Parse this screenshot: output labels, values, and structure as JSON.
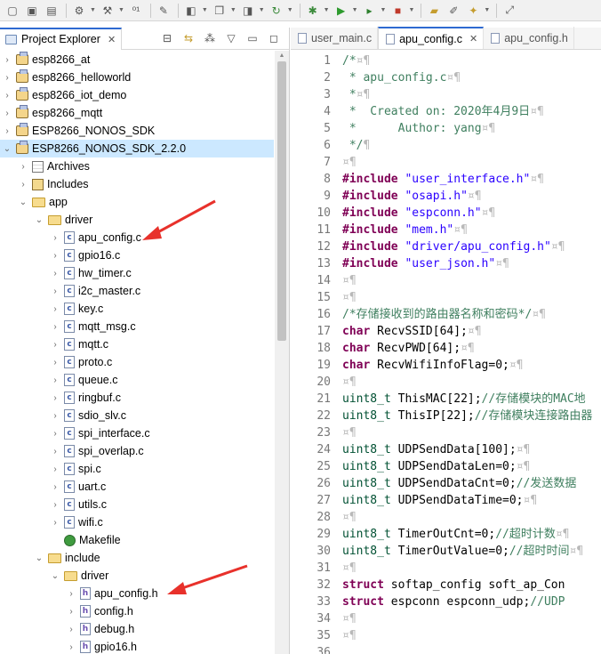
{
  "explorer": {
    "title": "Project Explorer",
    "close": "✕",
    "tree": [
      {
        "label": "esp8266_at",
        "kind": "project",
        "depth": 0,
        "twisty": "›"
      },
      {
        "label": "esp8266_helloworld",
        "kind": "project",
        "depth": 0,
        "twisty": "›"
      },
      {
        "label": "esp8266_iot_demo",
        "kind": "project",
        "depth": 0,
        "twisty": "›"
      },
      {
        "label": "esp8266_mqtt",
        "kind": "project",
        "depth": 0,
        "twisty": "›"
      },
      {
        "label": "ESP8266_NONOS_SDK",
        "kind": "project",
        "depth": 0,
        "twisty": "›"
      },
      {
        "label": "ESP8266_NONOS_SDK_2.2.0",
        "kind": "project",
        "depth": 0,
        "twisty": "⌄",
        "selected": true
      },
      {
        "label": "Archives",
        "kind": "archive",
        "depth": 1,
        "twisty": "›"
      },
      {
        "label": "Includes",
        "kind": "includes",
        "depth": 1,
        "twisty": "›"
      },
      {
        "label": "app",
        "kind": "folder-open",
        "depth": 1,
        "twisty": "⌄"
      },
      {
        "label": "driver",
        "kind": "folder-open",
        "depth": 2,
        "twisty": "⌄"
      },
      {
        "label": "apu_config.c",
        "kind": "c",
        "depth": 3,
        "twisty": "›"
      },
      {
        "label": "gpio16.c",
        "kind": "c",
        "depth": 3,
        "twisty": "›"
      },
      {
        "label": "hw_timer.c",
        "kind": "c",
        "depth": 3,
        "twisty": "›"
      },
      {
        "label": "i2c_master.c",
        "kind": "c",
        "depth": 3,
        "twisty": "›"
      },
      {
        "label": "key.c",
        "kind": "c",
        "depth": 3,
        "twisty": "›"
      },
      {
        "label": "mqtt_msg.c",
        "kind": "c",
        "depth": 3,
        "twisty": "›"
      },
      {
        "label": "mqtt.c",
        "kind": "c",
        "depth": 3,
        "twisty": "›"
      },
      {
        "label": "proto.c",
        "kind": "c",
        "depth": 3,
        "twisty": "›"
      },
      {
        "label": "queue.c",
        "kind": "c",
        "depth": 3,
        "twisty": "›"
      },
      {
        "label": "ringbuf.c",
        "kind": "c",
        "depth": 3,
        "twisty": "›"
      },
      {
        "label": "sdio_slv.c",
        "kind": "c",
        "depth": 3,
        "twisty": "›"
      },
      {
        "label": "spi_interface.c",
        "kind": "c",
        "depth": 3,
        "twisty": "›"
      },
      {
        "label": "spi_overlap.c",
        "kind": "c",
        "depth": 3,
        "twisty": "›"
      },
      {
        "label": "spi.c",
        "kind": "c",
        "depth": 3,
        "twisty": "›"
      },
      {
        "label": "uart.c",
        "kind": "c",
        "depth": 3,
        "twisty": "›"
      },
      {
        "label": "utils.c",
        "kind": "c",
        "depth": 3,
        "twisty": "›"
      },
      {
        "label": "wifi.c",
        "kind": "c",
        "depth": 3,
        "twisty": "›"
      },
      {
        "label": "Makefile",
        "kind": "make",
        "depth": 3,
        "twisty": ""
      },
      {
        "label": "include",
        "kind": "folder-open",
        "depth": 2,
        "twisty": "⌄"
      },
      {
        "label": "driver",
        "kind": "folder-open",
        "depth": 3,
        "twisty": "⌄"
      },
      {
        "label": "apu_config.h",
        "kind": "h",
        "depth": 4,
        "twisty": "›"
      },
      {
        "label": "config.h",
        "kind": "h",
        "depth": 4,
        "twisty": "›"
      },
      {
        "label": "debug.h",
        "kind": "h",
        "depth": 4,
        "twisty": "›"
      },
      {
        "label": "gpio16.h",
        "kind": "h",
        "depth": 4,
        "twisty": "›"
      }
    ]
  },
  "editor": {
    "tabs": [
      {
        "label": "user_main.c",
        "active": false,
        "close": ""
      },
      {
        "label": "apu_config.c",
        "active": true,
        "close": "✕"
      },
      {
        "label": "apu_config.h",
        "active": false,
        "close": ""
      }
    ],
    "lines": [
      [
        {
          "t": "/*",
          "c": "cm"
        },
        {
          "t": "¤¶",
          "c": "ws"
        }
      ],
      [
        {
          "t": " * ",
          "c": "cm"
        },
        {
          "t": "apu_config.c",
          "c": "cm"
        },
        {
          "t": "¤¶",
          "c": "ws"
        }
      ],
      [
        {
          "t": " *",
          "c": "cm"
        },
        {
          "t": "¤¶",
          "c": "ws"
        }
      ],
      [
        {
          "t": " *  Created on: 2020年4月9日",
          "c": "cm"
        },
        {
          "t": "¤¶",
          "c": "ws"
        }
      ],
      [
        {
          "t": " *      Author: yang",
          "c": "cm"
        },
        {
          "t": "¤¶",
          "c": "ws"
        }
      ],
      [
        {
          "t": " */",
          "c": "cm"
        },
        {
          "t": "¶",
          "c": "ws"
        }
      ],
      [
        {
          "t": "¤¶",
          "c": "ws"
        }
      ],
      [
        {
          "t": "#include ",
          "c": "kw"
        },
        {
          "t": "\"user_interface.h\"",
          "c": "st"
        },
        {
          "t": "¤¶",
          "c": "ws"
        }
      ],
      [
        {
          "t": "#include ",
          "c": "kw"
        },
        {
          "t": "\"osapi.h\"",
          "c": "st"
        },
        {
          "t": "¤¶",
          "c": "ws"
        }
      ],
      [
        {
          "t": "#include ",
          "c": "kw"
        },
        {
          "t": "\"espconn.h\"",
          "c": "st"
        },
        {
          "t": "¤¶",
          "c": "ws"
        }
      ],
      [
        {
          "t": "#include ",
          "c": "kw"
        },
        {
          "t": "\"mem.h\"",
          "c": "st"
        },
        {
          "t": "¤¶",
          "c": "ws"
        }
      ],
      [
        {
          "t": "#include ",
          "c": "kw"
        },
        {
          "t": "\"driver/apu_config.h\"",
          "c": "st"
        },
        {
          "t": "¤¶",
          "c": "ws"
        }
      ],
      [
        {
          "t": "#include ",
          "c": "kw"
        },
        {
          "t": "\"user_json.h\"",
          "c": "st"
        },
        {
          "t": "¤¶",
          "c": "ws"
        }
      ],
      [
        {
          "t": "¤¶",
          "c": "ws"
        }
      ],
      [
        {
          "t": "¤¶",
          "c": "ws"
        }
      ],
      [
        {
          "t": "/*存储接收到的路由器名称和密码*/",
          "c": "cm"
        },
        {
          "t": "¤¶",
          "c": "ws"
        }
      ],
      [
        {
          "t": "char ",
          "c": "kw"
        },
        {
          "t": "RecvSSID[64];",
          "c": ""
        },
        {
          "t": "¤¶",
          "c": "ws"
        }
      ],
      [
        {
          "t": "char ",
          "c": "kw"
        },
        {
          "t": "RecvPWD[64];",
          "c": ""
        },
        {
          "t": "¤¶",
          "c": "ws"
        }
      ],
      [
        {
          "t": "char ",
          "c": "kw"
        },
        {
          "t": "RecvWifiInfoFlag=0;",
          "c": ""
        },
        {
          "t": "¤¶",
          "c": "ws"
        }
      ],
      [
        {
          "t": "¤¶",
          "c": "ws"
        }
      ],
      [
        {
          "t": "uint8_t ",
          "c": "ty"
        },
        {
          "t": "ThisMAC[22];",
          "c": ""
        },
        {
          "t": "//存储模块的MAC地",
          "c": "cm"
        }
      ],
      [
        {
          "t": "uint8_t ",
          "c": "ty"
        },
        {
          "t": "ThisIP[22];",
          "c": ""
        },
        {
          "t": "//存储模块连接路由器",
          "c": "cm"
        }
      ],
      [
        {
          "t": "¤¶",
          "c": "ws"
        }
      ],
      [
        {
          "t": "uint8_t ",
          "c": "ty"
        },
        {
          "t": "UDPSendData[100];",
          "c": ""
        },
        {
          "t": "¤¶",
          "c": "ws"
        }
      ],
      [
        {
          "t": "uint8_t ",
          "c": "ty"
        },
        {
          "t": "UDPSendDataLen=0;",
          "c": ""
        },
        {
          "t": "¤¶",
          "c": "ws"
        }
      ],
      [
        {
          "t": "uint8_t ",
          "c": "ty"
        },
        {
          "t": "UDPSendDataCnt=0;",
          "c": ""
        },
        {
          "t": "//发送数据",
          "c": "cm"
        }
      ],
      [
        {
          "t": "uint8_t ",
          "c": "ty"
        },
        {
          "t": "UDPSendDataTime=0;",
          "c": ""
        },
        {
          "t": "¤¶",
          "c": "ws"
        }
      ],
      [
        {
          "t": "¤¶",
          "c": "ws"
        }
      ],
      [
        {
          "t": "uint8_t ",
          "c": "ty"
        },
        {
          "t": "TimerOutCnt=0;",
          "c": ""
        },
        {
          "t": "//超时计数",
          "c": "cm"
        },
        {
          "t": "¤¶",
          "c": "ws"
        }
      ],
      [
        {
          "t": "uint8_t ",
          "c": "ty"
        },
        {
          "t": "TimerOutValue=0;",
          "c": ""
        },
        {
          "t": "//超时时间",
          "c": "cm"
        },
        {
          "t": "¤¶",
          "c": "ws"
        }
      ],
      [
        {
          "t": "¤¶",
          "c": "ws"
        }
      ],
      [
        {
          "t": "struct ",
          "c": "kw"
        },
        {
          "t": "softap_config soft_ap_Con",
          "c": ""
        }
      ],
      [
        {
          "t": "struct ",
          "c": "kw"
        },
        {
          "t": "espconn espconn_udp;",
          "c": ""
        },
        {
          "t": "//UDP",
          "c": "cm"
        }
      ],
      [
        {
          "t": "¤¶",
          "c": "ws"
        }
      ],
      [
        {
          "t": "¤¶",
          "c": "ws"
        }
      ],
      [
        {
          "t": "",
          "c": ""
        }
      ]
    ]
  },
  "colors": {
    "selection": "#cce8ff",
    "active_tab_accent": "#2e6ad1",
    "annotation_arrow": "#e8312b",
    "keyword": "#7f0055",
    "string": "#2a00ff",
    "comment": "#3f7f5f"
  },
  "toolbar": {
    "icons": [
      "new-file-icon",
      "save-icon",
      "save-all-icon",
      "build-settings-icon",
      "hammer-icon",
      "binary-icon",
      "debug-config-icon",
      "new-class-icon",
      "open-type-icon",
      "new-header-icon",
      "refresh-icon",
      "bug-icon",
      "run-icon",
      "external-tools-icon",
      "stop-icon",
      "open-folder-icon",
      "edit-icon",
      "pin-icon",
      "link-icon"
    ]
  }
}
